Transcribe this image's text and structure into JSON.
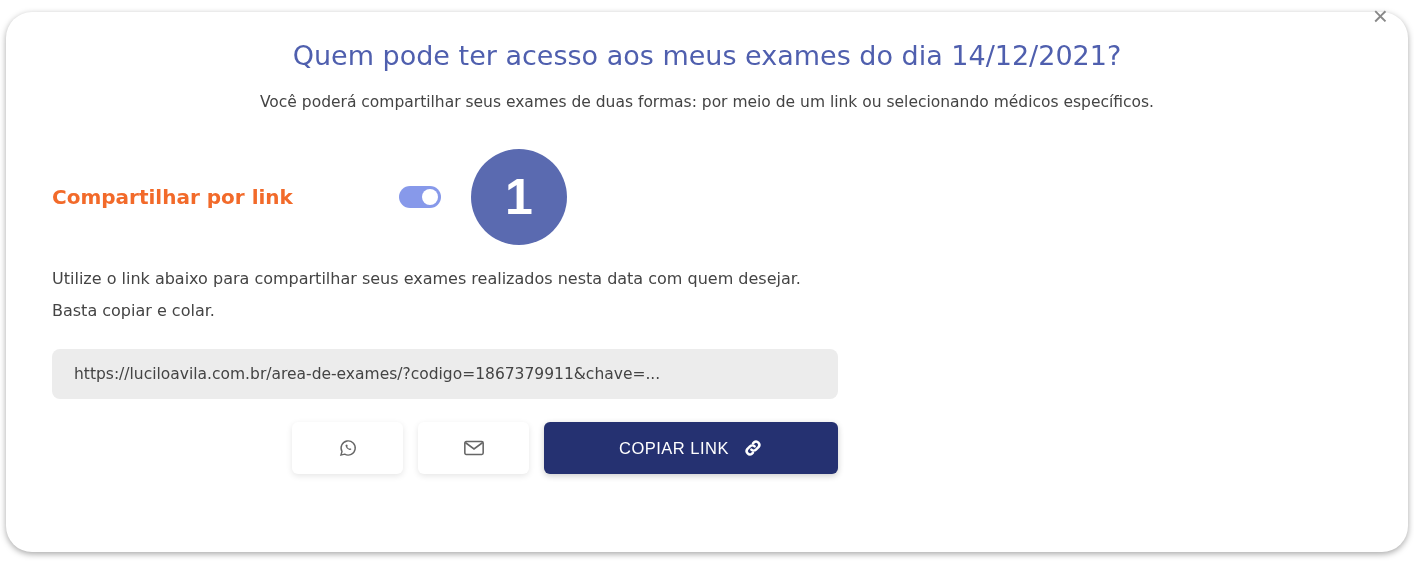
{
  "dialog": {
    "title": "Quem pode ter acesso aos meus exames do dia 14/12/2021?",
    "subtitle": "Você poderá compartilhar seus exames de duas formas: por meio de um link ou selecionando médicos específicos.",
    "close": "×"
  },
  "share_link": {
    "label": "Compartilhar por link",
    "on": true,
    "step_badge": "1",
    "description": "Utilize o link abaixo para compartilhar seus exames realizados nesta data com quem desejar. Basta copiar e colar.",
    "link_value": "https://luciloavila.com.br/area-de-exames/?codigo=1867379911&chave=...",
    "buttons": [
      {
        "kind": "whatsapp"
      },
      {
        "kind": "email"
      },
      {
        "kind": "copy",
        "label": "COPIAR LINK"
      }
    ]
  }
}
